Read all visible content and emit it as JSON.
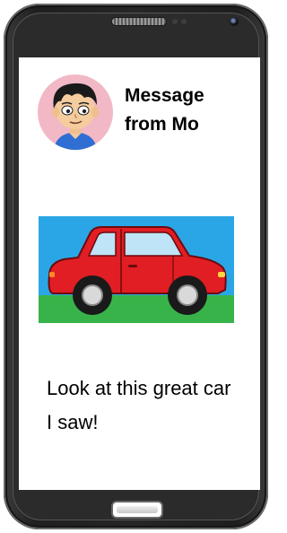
{
  "message": {
    "sender_title": "Message from Mo",
    "body": "Look at this great car I saw!"
  },
  "icons": {
    "avatar": "boy-avatar-icon",
    "image": "red-car-illustration"
  },
  "colors": {
    "avatar_bg": "#f2b8c6",
    "sky": "#2aa6e6",
    "grass": "#37b34a",
    "car_body": "#e01e24"
  }
}
